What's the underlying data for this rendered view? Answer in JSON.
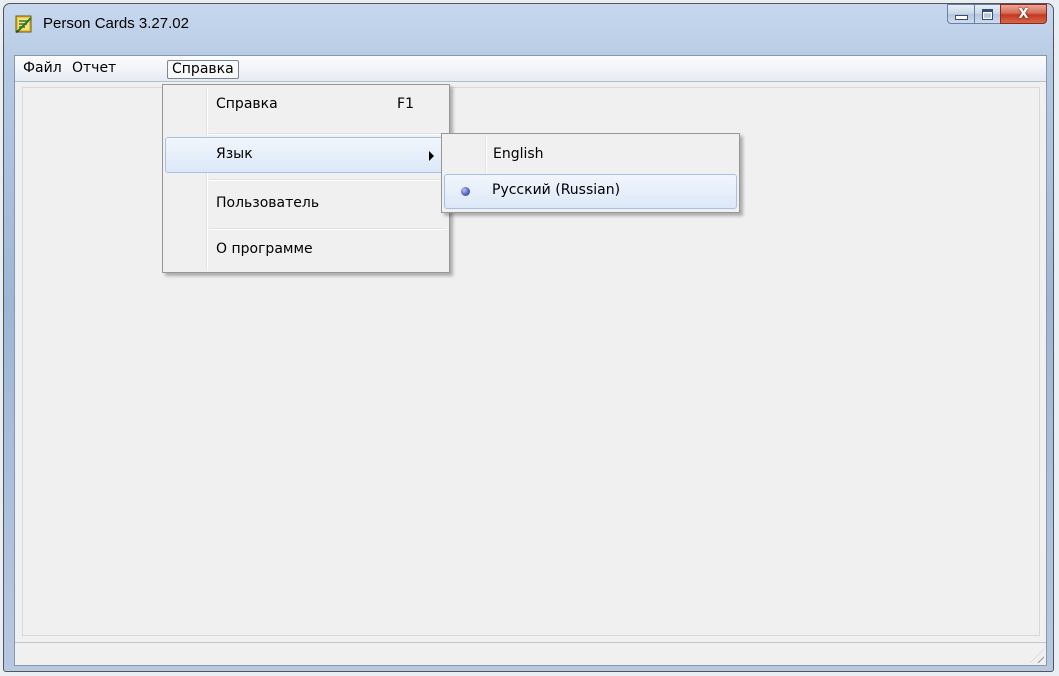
{
  "window": {
    "title": "Person Cards 3.27.02",
    "app_icon": "notebook-pencil-icon",
    "caption_buttons": [
      "minimize-icon",
      "maximize-icon",
      "close-icon"
    ],
    "close_glyph": "X"
  },
  "menubar": {
    "items": [
      {
        "label": "Файл"
      },
      {
        "label": "Отчет"
      },
      {
        "label": "Справка",
        "open": true
      }
    ]
  },
  "help_menu": {
    "items": [
      {
        "label": "Справка",
        "shortcut": "F1"
      },
      {
        "label": "Язык",
        "has_submenu": true,
        "highlighted": true
      },
      {
        "label": "Пользователь"
      },
      {
        "label": "О программе"
      }
    ]
  },
  "language_submenu": {
    "items": [
      {
        "label": "English",
        "checked": false
      },
      {
        "label": "Русский (Russian)",
        "checked": true
      }
    ]
  },
  "colors": {
    "highlight_border": "#a8c2e6",
    "close_button": "#c2391f",
    "radio_dot": "#4f63c2"
  }
}
